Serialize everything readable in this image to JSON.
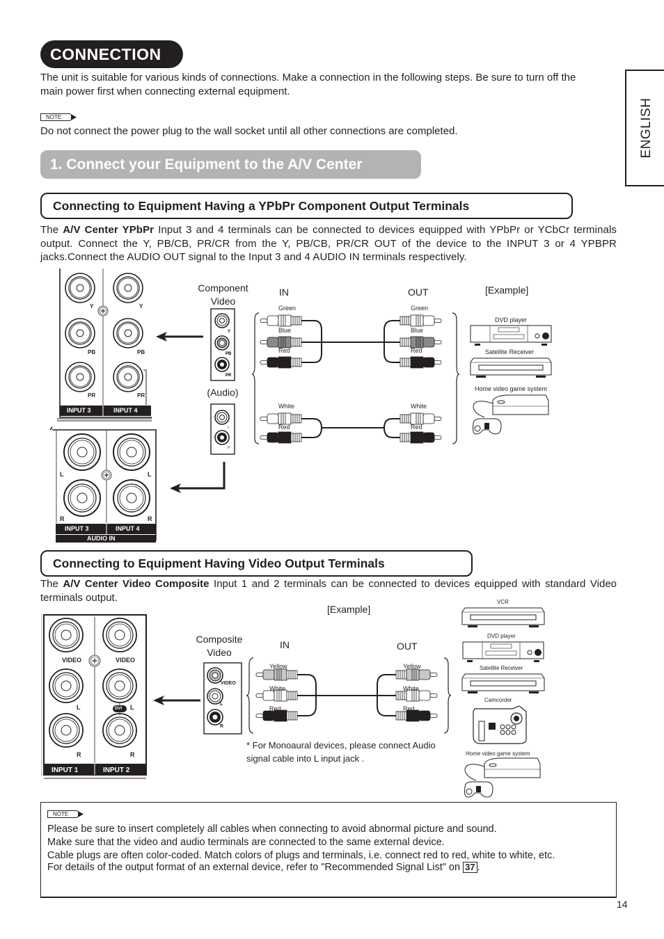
{
  "page": {
    "title": "CONNECTION",
    "intro": "The unit is suitable for various kinds of connections. Make a connection in the following steps. Be sure to turn off the main power first when connecting external equipment.",
    "note_label": "NOTE",
    "note_power": "Do not connect the power plug to the wall socket until all other connections are completed.",
    "language_tab": "ENGLISH",
    "page_number": "14"
  },
  "step1": {
    "title": "1. Connect your Equipment to the A/V Center"
  },
  "ypbpr_section": {
    "title": "Connecting to Equipment Having a YPbPr Component Output Terminals",
    "text_prefix": "The ",
    "text_bold": "A/V Center YPbPr",
    "text_rest": " Input 3 and 4 terminals can be connected to devices equipped with YPbPr or YCbCr terminals output. Connect the Y, PB/CB, PR/CR from the Y, PB/CB, PR/CR OUT of the device to the INPUT 3 or 4 YPBPR jacks.Connect the AUDIO OUT signal to the Input 3 and 4 AUDIO IN terminals respectively.",
    "panel_video": {
      "jack_labels": [
        "Y",
        "PB",
        "PR"
      ],
      "inputs": [
        "INPUT 3",
        "INPUT 4"
      ]
    },
    "panel_audio": {
      "jack_labels": [
        "L",
        "R"
      ],
      "inputs": [
        "INPUT 3",
        "INPUT 4"
      ],
      "footer": "AUDIO IN"
    },
    "component_label": "Component Video",
    "component_jacks": [
      "Y",
      "PB",
      "PR"
    ],
    "audio_label": "(Audio)",
    "audio_jacks": [
      "L",
      "R"
    ],
    "in_label": "IN",
    "out_label": "OUT",
    "video_cables": [
      "Green",
      "Blue",
      "Red"
    ],
    "audio_cables": [
      "White",
      "Red"
    ],
    "example_label": "[Example]",
    "devices": [
      "DVD player",
      "Satellite Receiver",
      "Home video game system"
    ]
  },
  "video_section": {
    "title": "Connecting to Equipment Having Video Output Terminals",
    "text_prefix": "The ",
    "text_bold": "A/V Center Video Composite",
    "text_rest": " Input 1 and 2 terminals can be connected to devices equipped with standard Video terminals output.",
    "panel": {
      "jack_labels": [
        "VIDEO",
        "L",
        "R"
      ],
      "dvi_badge": "DVI",
      "inputs": [
        "INPUT 1",
        "INPUT 2"
      ]
    },
    "composite_label": "Composite Video",
    "composite_jacks": [
      "VIDEO",
      "L",
      "R"
    ],
    "in_label": "IN",
    "out_label": "OUT",
    "cables": [
      "Yellow",
      "White",
      "Red"
    ],
    "mono_note": "* For Monoaural devices, please connect Audio signal cable into L input jack .",
    "example_label": "[Example]",
    "devices": [
      "VCR",
      "DVD player",
      "Satellite Receiver",
      "Camcorder",
      "Home video game system"
    ]
  },
  "bottom_note": {
    "label": "NOTE",
    "lines": [
      "Please be sure to insert completely all cables when connecting to avoid abnormal picture and sound.",
      "Make sure that the video and audio terminals are connected to the same external device.",
      "Cable plugs are often color-coded. Match colors of plugs and terminals, i.e. connect red to red, white to white, etc."
    ],
    "last_line_prefix": "For details of the output format of an external device, refer to \"Recommended Signal List\" on ",
    "page_ref": "37",
    "last_line_suffix": "."
  }
}
